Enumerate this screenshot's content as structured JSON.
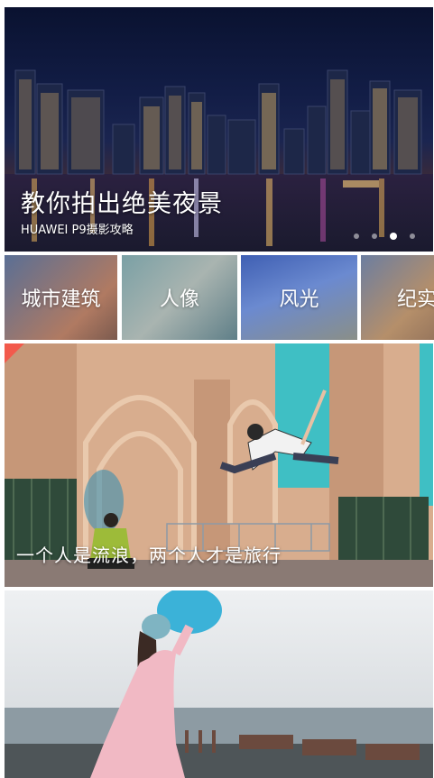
{
  "hero": {
    "title": "教你拍出绝美夜景",
    "subtitle": "HUAWEI P9摄影攻略",
    "slide_count": 4,
    "active_slide": 3
  },
  "categories": [
    {
      "label": "城市建筑",
      "color": "#6c7fa0"
    },
    {
      "label": "人像",
      "color": "#6f9aa0"
    },
    {
      "label": "风光",
      "color": "#4d6ab0"
    },
    {
      "label": "纪实",
      "color": "#a58a6e"
    }
  ],
  "cards": [
    {
      "caption": "一个人是流浪，两个人才是旅行",
      "badge_color": "#f25a4c"
    },
    {
      "caption": ""
    }
  ],
  "colors": {
    "accent": "#f25a4c",
    "background": "#ffffff"
  }
}
